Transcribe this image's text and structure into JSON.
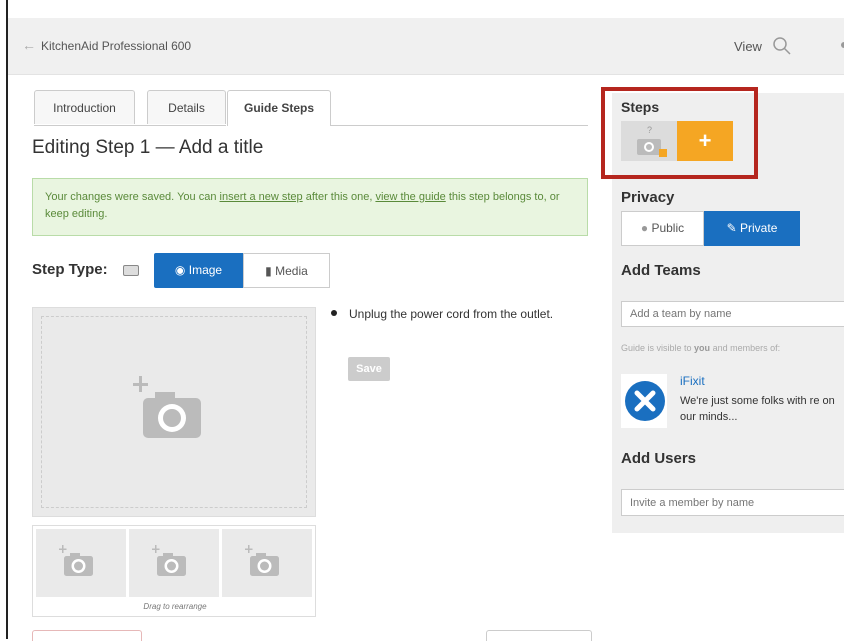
{
  "header": {
    "back_icon": "arrow-left-icon",
    "title": "KitchenAid Professional 600",
    "view_label": "View"
  },
  "tabs": [
    {
      "label": "Introduction"
    },
    {
      "label": "Details"
    },
    {
      "label": "Guide Steps"
    }
  ],
  "editing_title": "Editing Step 1 — Add a title",
  "notice": {
    "prefix": "Your changes were saved. You can ",
    "link1": "insert a new step",
    "middle": " after this one, ",
    "link2": "view the guide",
    "suffix": " this step belongs to, or keep editing."
  },
  "step_type": {
    "label": "Step Type:",
    "image_label": "Image",
    "media_label": "Media"
  },
  "thumbs_hint": "Drag to rearrange",
  "bullet_text": "Unplug the power cord from the outlet.",
  "save_label": "Save",
  "sidebar": {
    "steps_label": "Steps",
    "add_step_symbol": "+",
    "privacy_label": "Privacy",
    "public_label": "Public",
    "private_label": "Private",
    "add_teams_label": "Add Teams",
    "team_placeholder": "Add a team by name",
    "visible_prefix": "Guide is visible to ",
    "visible_you": "you",
    "visible_suffix": " and members of:",
    "team_name": "iFixit",
    "team_desc": "We're just some folks with re on our minds...",
    "add_users_label": "Add Users",
    "user_placeholder": "Invite a member by name"
  },
  "colors": {
    "primary": "#1a6fc0",
    "accent_orange": "#f5a623",
    "highlight_red": "#b5261e",
    "success_bg": "#e9f5e0"
  }
}
